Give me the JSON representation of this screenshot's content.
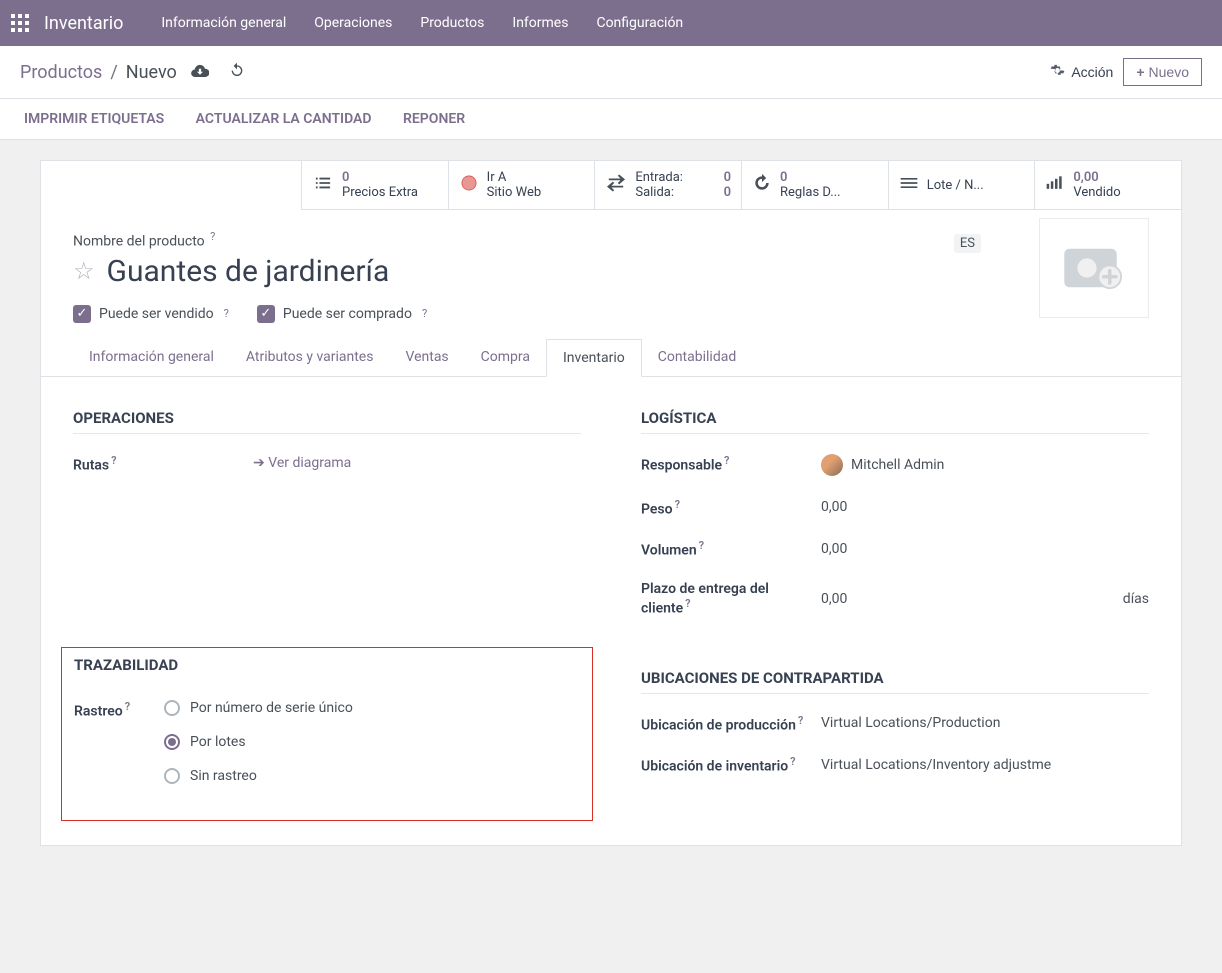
{
  "nav": {
    "brand": "Inventario",
    "items": [
      "Información general",
      "Operaciones",
      "Productos",
      "Informes",
      "Configuración"
    ]
  },
  "header": {
    "bc_root": "Productos",
    "bc_new": "Nuevo",
    "action_label": "Acción",
    "new_label": "Nuevo"
  },
  "actionbar": {
    "print": "IMPRIMIR ETIQUETAS",
    "update_qty": "ACTUALIZAR LA CANTIDAD",
    "replenish": "REPONER"
  },
  "stats": {
    "s0_num": "0",
    "s0_lbl": "Precios Extra",
    "s1_a": "Ir A",
    "s1_b": "Sitio Web",
    "s2_in_lbl": "Entrada:",
    "s2_in": "0",
    "s2_out_lbl": "Salida:",
    "s2_out": "0",
    "s3_num": "0",
    "s3_lbl": "Reglas D...",
    "s4_lbl": "Lote / N...",
    "s5_num": "0,00",
    "s5_lbl": "Vendido"
  },
  "product": {
    "name_label": "Nombre del producto",
    "name": "Guantes de jardinería",
    "lang": "ES",
    "can_sell": "Puede ser vendido",
    "can_buy": "Puede ser comprado"
  },
  "tabs": {
    "t0": "Información general",
    "t1": "Atributos y variantes",
    "t2": "Ventas",
    "t3": "Compra",
    "t4": "Inventario",
    "t5": "Contabilidad"
  },
  "left": {
    "sec1": "OPERACIONES",
    "routes": "Rutas",
    "see_diagram": "Ver diagrama",
    "sec2": "TRAZABILIDAD",
    "tracking_label": "Rastreo",
    "r0": "Por número de serie único",
    "r1": "Por lotes",
    "r2": "Sin rastreo"
  },
  "right": {
    "sec1": "LOGÍSTICA",
    "resp": "Responsable",
    "resp_val": "Mitchell Admin",
    "weight": "Peso",
    "weight_val": "0,00",
    "volume": "Volumen",
    "volume_val": "0,00",
    "lead": "Plazo de entrega del cliente",
    "lead_val": "0,00",
    "lead_unit": "días",
    "sec2": "UBICACIONES DE CONTRAPARTIDA",
    "prod_loc": "Ubicación de producción",
    "prod_loc_val": "Virtual Locations/Production",
    "inv_loc": "Ubicación de inventario",
    "inv_loc_val": "Virtual Locations/Inventory adjustme"
  }
}
